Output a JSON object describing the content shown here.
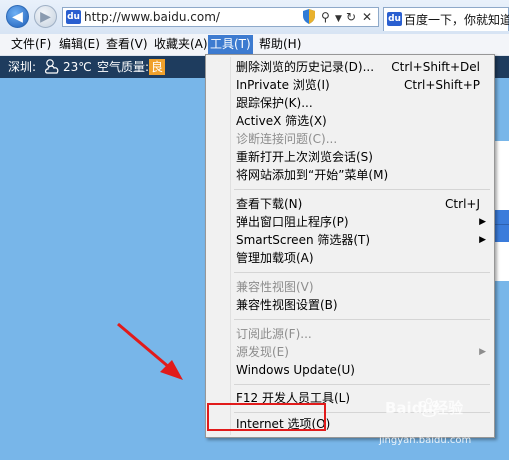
{
  "browser": {
    "address_url": "http://www.baidu.com/",
    "tab_title": "百度一下，你就知道",
    "favicon_text": "du"
  },
  "menubar": {
    "items": [
      {
        "label": "文件(F)"
      },
      {
        "label": "编辑(E)"
      },
      {
        "label": "查看(V)"
      },
      {
        "label": "收藏夹(A)"
      },
      {
        "label": "工具(T)"
      },
      {
        "label": "帮助(H)"
      }
    ]
  },
  "weather": {
    "city": "深圳:",
    "temperature": "23℃",
    "aq_label": "空气质量:",
    "aq_value": "良"
  },
  "tools_menu": {
    "items": [
      {
        "label": "删除浏览的历史记录(D)...",
        "shortcut": "Ctrl+Shift+Del"
      },
      {
        "label": "InPrivate 浏览(I)",
        "shortcut": "Ctrl+Shift+P"
      },
      {
        "label": "跟踪保护(K)..."
      },
      {
        "label": "ActiveX 筛选(X)"
      },
      {
        "label": "诊断连接问题(C)...",
        "disabled": true
      },
      {
        "label": "重新打开上次浏览会话(S)"
      },
      {
        "label": "将网站添加到“开始”菜单(M)"
      },
      {
        "label": "查看下载(N)",
        "shortcut": "Ctrl+J"
      },
      {
        "label": "弹出窗口阻止程序(P)",
        "submenu": true
      },
      {
        "label": "SmartScreen 筛选器(T)",
        "submenu": true
      },
      {
        "label": "管理加载项(A)"
      },
      {
        "label": "兼容性视图(V)",
        "disabled": true
      },
      {
        "label": "兼容性视图设置(B)"
      },
      {
        "label": "订阅此源(F)...",
        "disabled": true
      },
      {
        "label": "源发现(E)",
        "disabled": true,
        "submenu": true
      },
      {
        "label": "Windows Update(U)"
      },
      {
        "label": "F12 开发人员工具(L)"
      },
      {
        "label": "Internet 选项(O)"
      }
    ],
    "submenu_arrow": "▶"
  },
  "watermark": {
    "brand": "Baidu经验",
    "url": "jingyan.baidu.com"
  },
  "colors": {
    "page_background": "#78b6e9",
    "highlight_border": "#e11b1b",
    "arrow": "#e11b1b",
    "active_menu": "#3d7bd0"
  }
}
